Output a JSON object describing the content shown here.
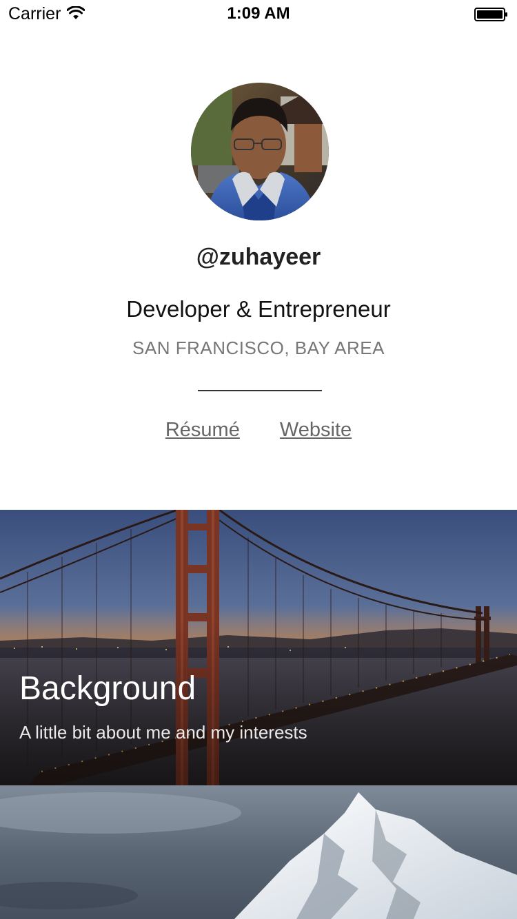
{
  "status_bar": {
    "carrier": "Carrier",
    "time": "1:09 AM",
    "icons": [
      "wifi-icon",
      "battery-icon"
    ]
  },
  "profile": {
    "handle": "@zuhayeer",
    "tagline": "Developer & Entrepreneur",
    "location": "SAN FRANCISCO, BAY AREA",
    "links": {
      "resume": "Résumé",
      "website": "Website"
    }
  },
  "cards": [
    {
      "title": "Background",
      "subtitle": "A little bit about me and my interests"
    }
  ],
  "colors": {
    "background": "#ffffff",
    "text_primary": "#111111",
    "text_secondary": "#777777",
    "link": "#666666"
  }
}
